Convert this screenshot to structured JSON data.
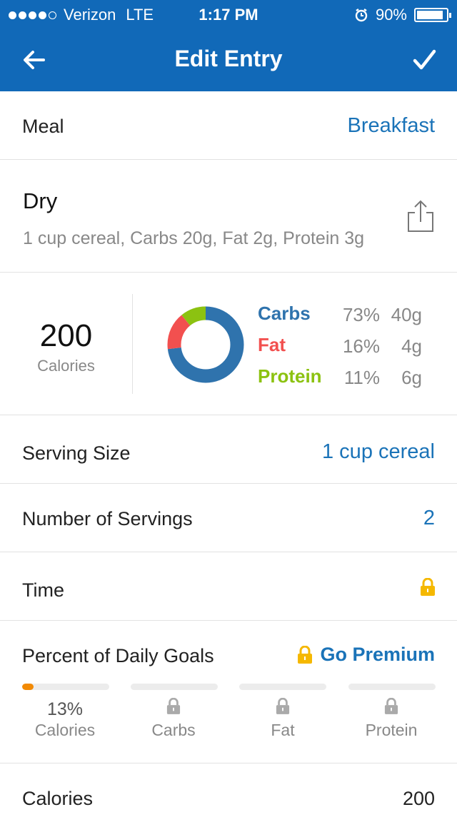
{
  "status_bar": {
    "carrier": "Verizon",
    "network": "LTE",
    "time": "1:17 PM",
    "battery": "90%",
    "battery_level": 0.9
  },
  "nav": {
    "title": "Edit Entry",
    "back_icon": "arrow-left-icon",
    "confirm_icon": "checkmark-icon"
  },
  "meal": {
    "label": "Meal",
    "value": "Breakfast"
  },
  "food": {
    "name": "Dry",
    "description": "1 cup cereal, Carbs 20g, Fat 2g, Protein 3g",
    "share_icon": "share-icon"
  },
  "nutrition": {
    "calories": "200",
    "calories_label": "Calories",
    "macros": [
      {
        "name": "Carbs",
        "percent": "73%",
        "grams": "40g",
        "color": "#2f73ad",
        "value": 73
      },
      {
        "name": "Fat",
        "percent": "16%",
        "grams": "4g",
        "color": "#f2504f",
        "value": 16
      },
      {
        "name": "Protein",
        "percent": "11%",
        "grams": "6g",
        "color": "#8cc211",
        "value": 11
      }
    ]
  },
  "serving_size": {
    "label": "Serving Size",
    "value": "1 cup cereal"
  },
  "servings": {
    "label": "Number of Servings",
    "value": "2"
  },
  "time": {
    "label": "Time",
    "icon": "lock-icon"
  },
  "daily_goals": {
    "title": "Percent of Daily Goals",
    "premium_label": "Go Premium",
    "items": [
      {
        "value": "13%",
        "label": "Calories",
        "progress": 0.13,
        "locked": false
      },
      {
        "value": "",
        "label": "Carbs",
        "progress": 0,
        "locked": true
      },
      {
        "value": "",
        "label": "Fat",
        "progress": 0,
        "locked": true
      },
      {
        "value": "",
        "label": "Protein",
        "progress": 0,
        "locked": true
      }
    ]
  },
  "calories_row": {
    "label": "Calories",
    "value": "200"
  },
  "colors": {
    "brand": "#1169b8",
    "link": "#1a73b8",
    "lock": "#f5b800",
    "progress": "#f28a05"
  }
}
